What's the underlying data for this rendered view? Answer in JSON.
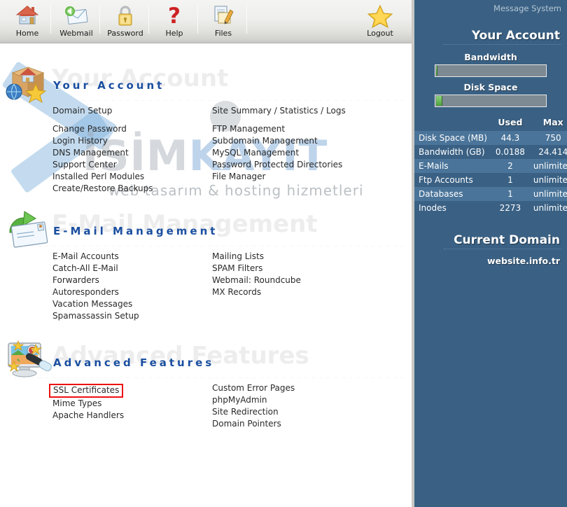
{
  "toolbar": {
    "items": [
      {
        "label": "Home",
        "icon": "house-icon"
      },
      {
        "label": "Webmail",
        "icon": "envelope-icon"
      },
      {
        "label": "Password",
        "icon": "padlock-icon"
      },
      {
        "label": "Help",
        "icon": "question-mark-icon"
      },
      {
        "label": "Files",
        "icon": "documents-pencil-icon"
      },
      {
        "label": "Logout",
        "icon": "star-icon"
      }
    ]
  },
  "watermark": {
    "brand_prefix": "İSİM",
    "brand_suffix": "KAYIT",
    "tagline": "web tasarım & hosting hizmetleri"
  },
  "sections": [
    {
      "title": "Your Account",
      "ghost": "Your Account",
      "icon": "account-box-house-icon",
      "left_links": [
        "Domain Setup",
        "Change Password",
        "Login History",
        "DNS Management",
        "Support Center",
        "Installed Perl Modules",
        "Create/Restore Backups"
      ],
      "right_links": [
        "Site Summary / Statistics / Logs",
        "FTP Management",
        "Subdomain Management",
        "MySQL Management",
        "Password Protected Directories",
        "File Manager"
      ]
    },
    {
      "title": "E-Mail Management",
      "ghost": "E-Mail Management",
      "icon": "envelope-arrow-icon",
      "left_links": [
        "E-Mail Accounts",
        "Catch-All E-Mail",
        "Forwarders",
        "Autoresponders",
        "Vacation Messages",
        "Spamassassin Setup"
      ],
      "right_links": [
        "Mailing Lists",
        "SPAM Filters",
        "Webmail: Roundcube",
        "MX Records"
      ]
    },
    {
      "title": "Advanced Features",
      "ghost": "Advanced Features",
      "icon": "monitor-stars-icon",
      "left_links": [
        "SSL Certificates",
        "Mime Types",
        "Apache Handlers"
      ],
      "right_links": [
        "Custom Error Pages",
        "phpMyAdmin",
        "Site Redirection",
        "Domain Pointers"
      ],
      "highlighted_link": "SSL Certificates"
    }
  ],
  "sidebar": {
    "message_system": "Message System",
    "account_heading": "Your Account",
    "bandwidth_label": "Bandwidth",
    "bandwidth_percent": 1,
    "diskspace_label": "Disk Space",
    "diskspace_percent": 6,
    "table": {
      "headers": [
        "",
        "Used",
        "Max"
      ],
      "rows": [
        {
          "name": "Disk Space (MB)",
          "used": "44.3",
          "max": "750"
        },
        {
          "name": "Bandwidth (GB)",
          "used": "0.0188",
          "max": "24.414"
        },
        {
          "name": "E-Mails",
          "used": "2",
          "max": "unlimited"
        },
        {
          "name": "Ftp Accounts",
          "used": "1",
          "max": "unlimited"
        },
        {
          "name": "Databases",
          "used": "1",
          "max": "unlimited"
        },
        {
          "name": "Inodes",
          "used": "2273",
          "max": "unlimited"
        }
      ]
    },
    "current_domain_heading": "Current Domain",
    "current_domain": "website.info.tr"
  },
  "colors": {
    "sidebar_bg": "#3a6184",
    "sidebar_alt_row": "#4a7499",
    "section_title": "#1b4fa0",
    "highlight_border": "#ee1111",
    "bar_fill": "#5aa845"
  }
}
